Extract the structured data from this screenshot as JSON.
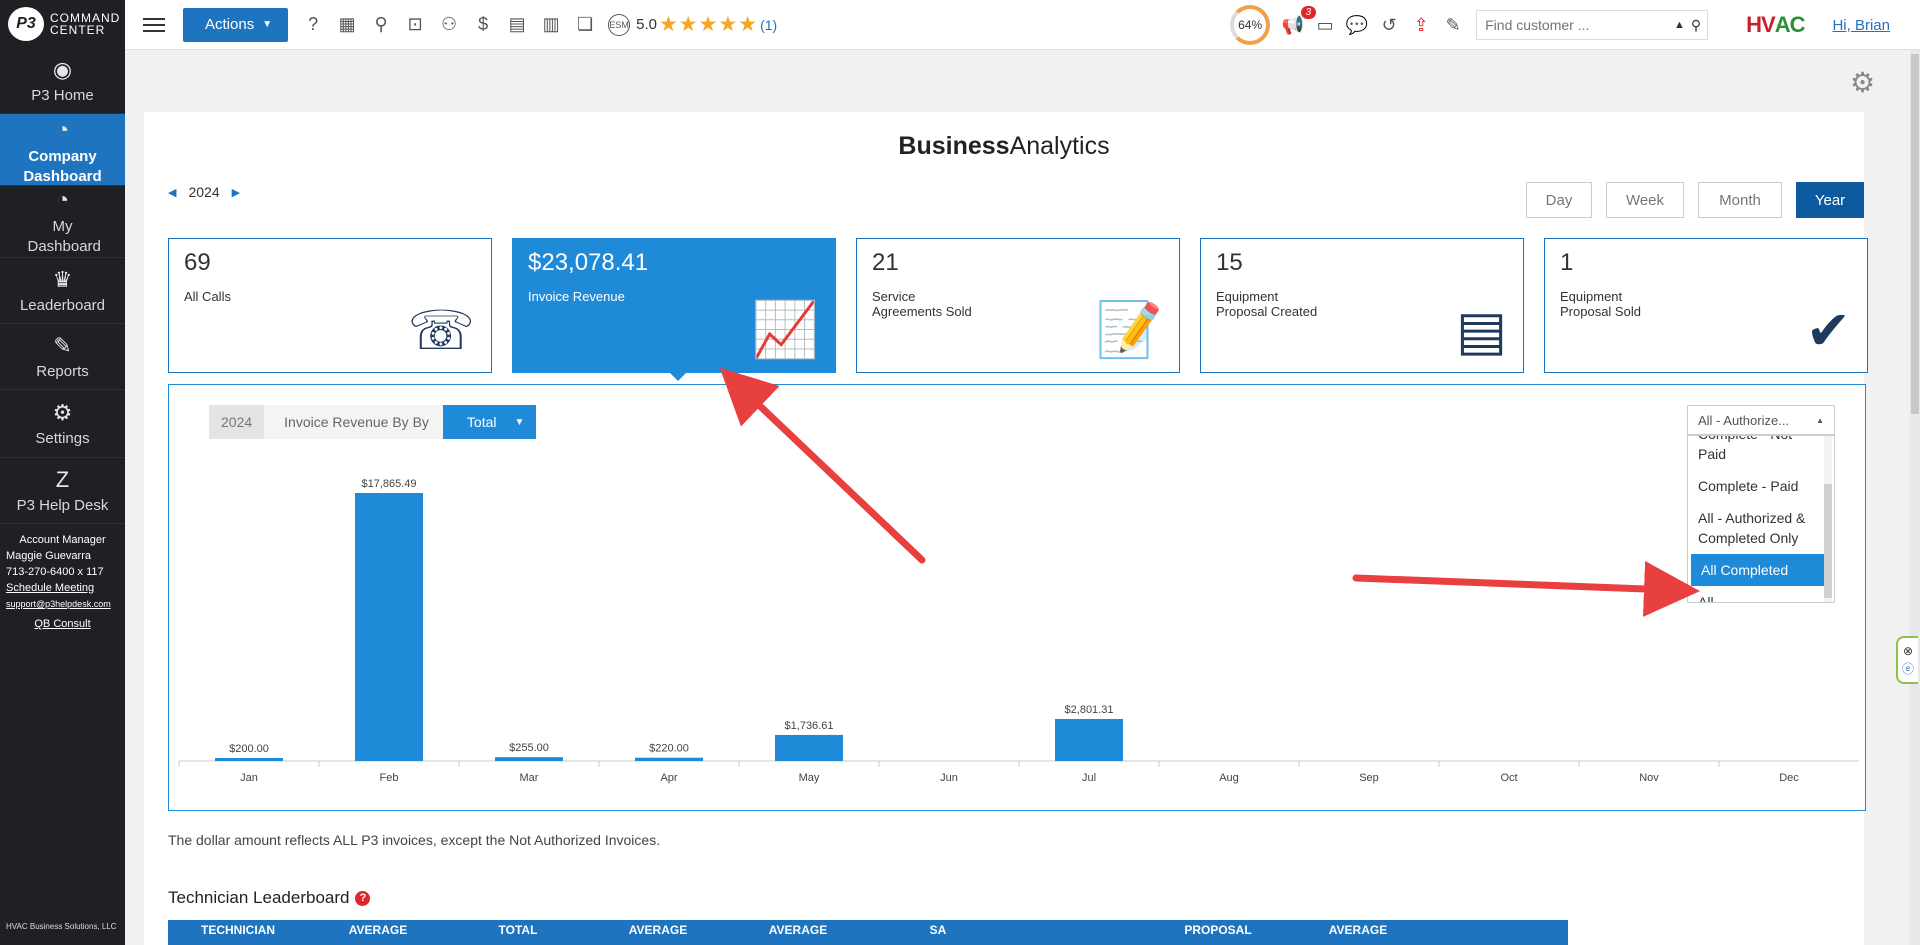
{
  "sidebar": {
    "brand": {
      "logo": "P3",
      "line1": "COMMAND",
      "line2": "CENTER"
    },
    "items": [
      {
        "label": "P3 Home",
        "icon": "p3-icon"
      },
      {
        "label": "Company Dashboard",
        "icon": "gauge-icon"
      },
      {
        "label": "My Dashboard",
        "icon": "gauge-icon"
      },
      {
        "label": "Leaderboard",
        "icon": "trophy-icon"
      },
      {
        "label": "Reports",
        "icon": "report-icon"
      },
      {
        "label": "Settings",
        "icon": "gear-icon"
      },
      {
        "label": "P3 Help Desk",
        "icon": "zendesk-icon"
      }
    ],
    "account": {
      "title": "Account Manager",
      "name": "Maggie Guevarra",
      "phone": "713-270-6400 x 117",
      "schedule": "Schedule Meeting",
      "email": "support@p3helpdesk.com",
      "qb": "QB Consult"
    },
    "footer": "HVAC Business Solutions, LLC"
  },
  "topbar": {
    "actions_label": "Actions",
    "rating_value": "5.0",
    "rating_stars": "★★★★★",
    "rating_count": "(1)",
    "progress": "64%",
    "notif_count": "3",
    "search_placeholder": "Find customer ...",
    "greeting": "Hi, Brian",
    "brand_left": "HV",
    "brand_right": "AC"
  },
  "page": {
    "title_bold": "Business",
    "title_light": "Analytics",
    "year": "2024",
    "periods": [
      "Day",
      "Week",
      "Month",
      "Year"
    ],
    "active_period": "Year"
  },
  "cards": [
    {
      "value": "69",
      "label": "All Calls",
      "icon": "phone-gear-icon"
    },
    {
      "value": "$23,078.41",
      "label": "Invoice Revenue",
      "icon": "revenue-growth-icon"
    },
    {
      "value": "21",
      "label": "Service\nAgreements Sold",
      "icon": "contract-icon"
    },
    {
      "value": "15",
      "label": "Equipment\nProposal Created",
      "icon": "equipment-icon"
    },
    {
      "value": "1",
      "label": "Equipment\nProposal Sold",
      "icon": "equipment-check-icon"
    }
  ],
  "breadcrumb": {
    "year": "2024",
    "label": "Invoice Revenue By By",
    "dropdown": "Total"
  },
  "filter": {
    "selected": "All - Authorize...",
    "options": [
      "Complete - Not Paid",
      "Complete - Paid",
      "All - Authorized & Completed Only",
      "All Completed",
      "All"
    ],
    "highlighted": "All Completed"
  },
  "chart_data": {
    "type": "bar",
    "categories": [
      "Jan",
      "Feb",
      "Mar",
      "Apr",
      "May",
      "Jun",
      "Jul",
      "Aug",
      "Sep",
      "Oct",
      "Nov",
      "Dec"
    ],
    "values": [
      200.0,
      17865.49,
      255.0,
      220.0,
      1736.61,
      null,
      2801.31,
      null,
      null,
      null,
      null,
      null
    ],
    "labels": [
      "$200.00",
      "$17,865.49",
      "$255.00",
      "$220.00",
      "$1,736.61",
      "",
      "$2,801.31",
      "",
      "",
      "",
      "",
      ""
    ],
    "ylim": [
      0,
      17865.49
    ],
    "color": "#1f8ad8"
  },
  "note": "The dollar amount reflects ALL P3 invoices, except the Not Authorized Invoices.",
  "leaderboard": {
    "title": "Technician Leaderboard",
    "headers": [
      "TECHNICIAN",
      "AVERAGE",
      "TOTAL",
      "AVERAGE",
      "AVERAGE",
      "SA",
      "",
      "PROPOSAL",
      "AVERAGE"
    ]
  },
  "colors": {
    "accent": "#1f74c0",
    "bar": "#1f8ad8",
    "sidebar": "#1e2023",
    "arrow": "#e8403e"
  }
}
